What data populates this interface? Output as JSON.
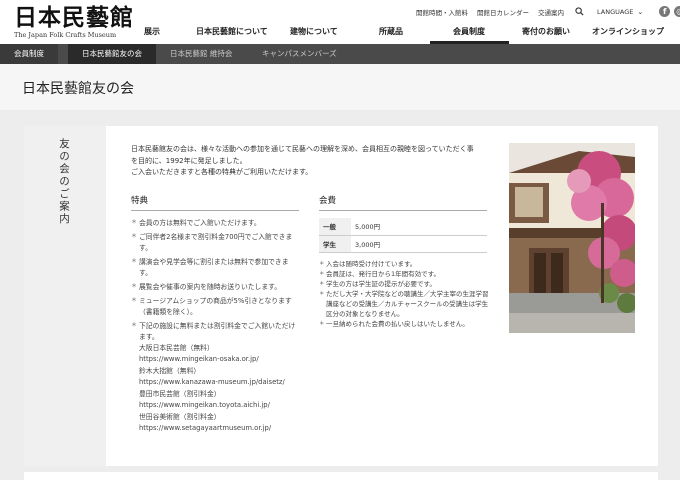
{
  "header": {
    "logo_kanji": "日本民藝館",
    "logo_en": "The Japan Folk Crafts Museum",
    "util_links": [
      "開館時間・入館料",
      "開館日カレンダー",
      "交通案内"
    ],
    "language_label": "LANGUAGE",
    "nav": [
      "展示",
      "日本民藝館について",
      "建物について",
      "所蔵品",
      "会員制度",
      "寄付のお願い",
      "オンラインショップ"
    ]
  },
  "subnav": {
    "items": [
      "会員制度",
      "日本民藝館友の会",
      "日本民藝館 維持会",
      "キャンパスメンバーズ"
    ]
  },
  "page": {
    "title": "日本民藝館友の会",
    "side_title": "友の会のご案内",
    "intro": [
      "日本民藝館友の会は、様々な活動への参加を通じて民藝への理解を深め、会員相互の親睦を図っていただく事",
      "を目的に、1992年に発足しました。",
      "ご入会いただきますと各種の特典がご利用いただけます。"
    ],
    "perks_heading": "特典",
    "perks": [
      "会員の方は無料でご入館いただけます。",
      "ご同伴者2名様まで割引料金700円でご入館できます。",
      "講演会や見学会等に割引または無料で参加できます。",
      "展覧会や催事の案内を随時お送りいたします。",
      "ミュージアムショップの商品が5%引きとなります（書籍類を除く）。"
    ],
    "last_perk": "下記の施設に無料または割引料金でご入館いただけます。",
    "facilities": [
      "大阪日本民芸館（無料）",
      "https://www.mingeikan-osaka.or.jp/",
      "鈴木大拙館（無料）",
      "https://www.kanazawa-museum.jp/daisetz/",
      "豊田市民芸館（割引料金）",
      "https://www.mingeikan.toyota.aichi.jp/",
      "世田谷美術館（割引料金）",
      "https://www.setagayaartmuseum.or.jp/"
    ],
    "fee_heading": "会費",
    "fees": [
      {
        "label": "一般",
        "value": "5,000円"
      },
      {
        "label": "学生",
        "value": "3,000円"
      }
    ],
    "notes": [
      "入会は随時受け付けています。",
      "会員証は、発行日から1年間有効です。",
      "学生の方は学生証の提示が必要です。",
      "ただし大学・大学院などの聴講生／大学主宰の生涯学習講座などの受講生／カルチャースクールの受講生は学生区分の対象となりません。",
      "一旦納められた会費の払い戻しはいたしません。"
    ]
  },
  "colors": {
    "subnav_bg": "#4a4a4a",
    "page_bg": "#ededed",
    "side_bg": "#f0f0f0"
  }
}
